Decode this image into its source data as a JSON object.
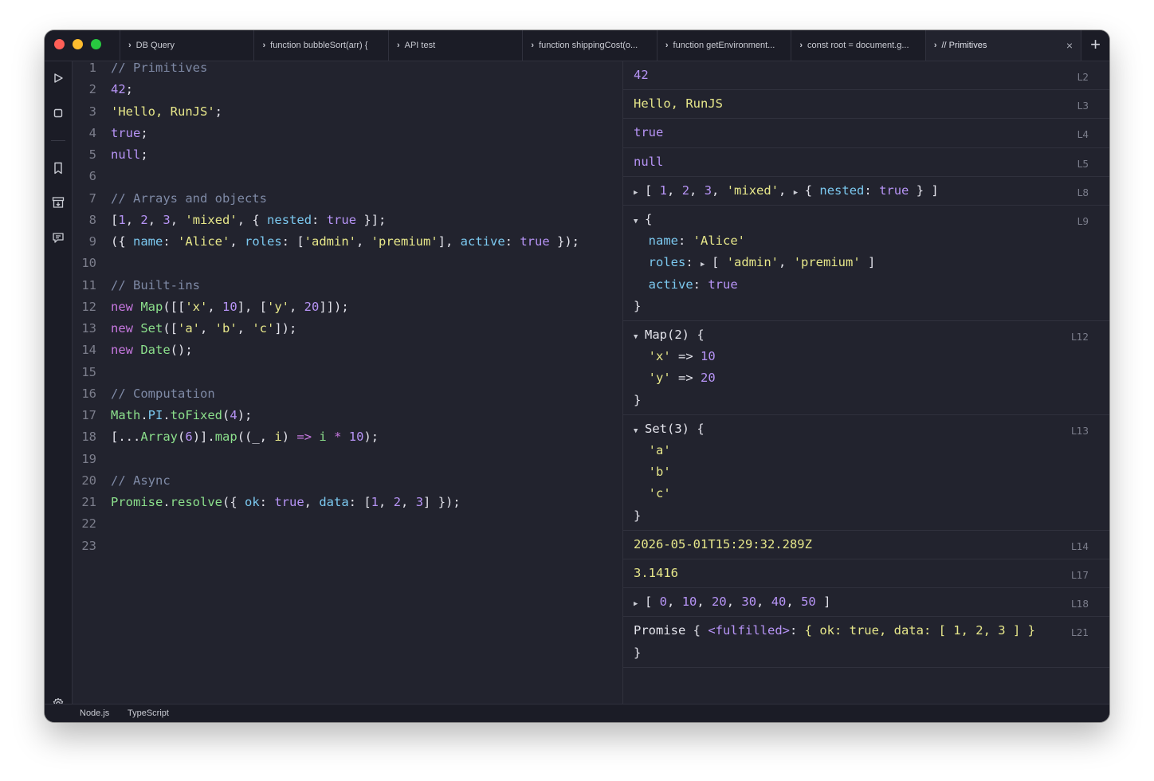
{
  "colors": {
    "window_bg": "#22232e",
    "chrome_bg": "#1b1c26",
    "close_light": "#ff5f57",
    "minimize_light": "#febc2e",
    "zoom_light": "#28c840",
    "comment": "#7f8aa6",
    "number": "#b794f6",
    "string": "#e7e78a",
    "keyword": "#c778e0",
    "class": "#8ce08c",
    "property": "#7cc9f0"
  },
  "tabs": [
    {
      "label": "DB Query"
    },
    {
      "label": "function bubbleSort(arr) {"
    },
    {
      "label": "API test"
    },
    {
      "label": "function shippingCost(o..."
    },
    {
      "label": "function getEnvironment..."
    },
    {
      "label": "const root = document.g..."
    },
    {
      "label": "// Primitives",
      "active": true
    }
  ],
  "tab_close_glyph": "×",
  "new_tab_glyph": "+",
  "sidebar": {
    "icons": [
      "play-icon",
      "stop-icon",
      "bookmark-icon",
      "archive-icon",
      "chat-icon",
      "gear-icon"
    ]
  },
  "editor": {
    "lines": [
      {
        "n": "1",
        "tokens": [
          [
            "c-cmt",
            "// Primitives"
          ]
        ]
      },
      {
        "n": "2",
        "tokens": [
          [
            "c-num",
            "42"
          ],
          [
            "c-punc",
            ";"
          ]
        ]
      },
      {
        "n": "3",
        "tokens": [
          [
            "c-str",
            "'Hello, RunJS'"
          ],
          [
            "c-punc",
            ";"
          ]
        ]
      },
      {
        "n": "4",
        "tokens": [
          [
            "c-bool",
            "true"
          ],
          [
            "c-punc",
            ";"
          ]
        ]
      },
      {
        "n": "5",
        "tokens": [
          [
            "c-bool",
            "null"
          ],
          [
            "c-punc",
            ";"
          ]
        ]
      },
      {
        "n": "6",
        "tokens": []
      },
      {
        "n": "7",
        "tokens": [
          [
            "c-cmt",
            "// Arrays and objects"
          ]
        ]
      },
      {
        "n": "8",
        "tokens": [
          [
            "c-punc",
            "["
          ],
          [
            "c-num",
            "1"
          ],
          [
            "c-punc",
            ", "
          ],
          [
            "c-num",
            "2"
          ],
          [
            "c-punc",
            ", "
          ],
          [
            "c-num",
            "3"
          ],
          [
            "c-punc",
            ", "
          ],
          [
            "c-str",
            "'mixed'"
          ],
          [
            "c-punc",
            ", { "
          ],
          [
            "c-prop",
            "nested"
          ],
          [
            "c-punc",
            ": "
          ],
          [
            "c-bool",
            "true"
          ],
          [
            "c-punc",
            " }];"
          ]
        ]
      },
      {
        "n": "9",
        "tokens": [
          [
            "c-punc",
            "({ "
          ],
          [
            "c-prop",
            "name"
          ],
          [
            "c-punc",
            ": "
          ],
          [
            "c-str",
            "'Alice'"
          ],
          [
            "c-punc",
            ", "
          ],
          [
            "c-prop",
            "roles"
          ],
          [
            "c-punc",
            ": ["
          ],
          [
            "c-str",
            "'admin'"
          ],
          [
            "c-punc",
            ", "
          ],
          [
            "c-str",
            "'premium'"
          ],
          [
            "c-punc",
            "], "
          ],
          [
            "c-prop",
            "active"
          ],
          [
            "c-punc",
            ": "
          ],
          [
            "c-bool",
            "true"
          ],
          [
            "c-punc",
            " });"
          ]
        ]
      },
      {
        "n": "10",
        "tokens": []
      },
      {
        "n": "11",
        "tokens": [
          [
            "c-cmt",
            "// Built-ins"
          ]
        ]
      },
      {
        "n": "12",
        "tokens": [
          [
            "c-kw",
            "new "
          ],
          [
            "c-cls",
            "Map"
          ],
          [
            "c-punc",
            "([["
          ],
          [
            "c-str",
            "'x'"
          ],
          [
            "c-punc",
            ", "
          ],
          [
            "c-num",
            "10"
          ],
          [
            "c-punc",
            "], ["
          ],
          [
            "c-str",
            "'y'"
          ],
          [
            "c-punc",
            ", "
          ],
          [
            "c-num",
            "20"
          ],
          [
            "c-punc",
            "]]);"
          ]
        ]
      },
      {
        "n": "13",
        "tokens": [
          [
            "c-kw",
            "new "
          ],
          [
            "c-cls",
            "Set"
          ],
          [
            "c-punc",
            "(["
          ],
          [
            "c-str",
            "'a'"
          ],
          [
            "c-punc",
            ", "
          ],
          [
            "c-str",
            "'b'"
          ],
          [
            "c-punc",
            ", "
          ],
          [
            "c-str",
            "'c'"
          ],
          [
            "c-punc",
            "]);"
          ]
        ]
      },
      {
        "n": "14",
        "tokens": [
          [
            "c-kw",
            "new "
          ],
          [
            "c-cls",
            "Date"
          ],
          [
            "c-punc",
            "();"
          ]
        ]
      },
      {
        "n": "15",
        "tokens": []
      },
      {
        "n": "16",
        "tokens": [
          [
            "c-cmt",
            "// Computation"
          ]
        ]
      },
      {
        "n": "17",
        "tokens": [
          [
            "c-cls",
            "Math"
          ],
          [
            "c-punc",
            "."
          ],
          [
            "c-prop",
            "PI"
          ],
          [
            "c-punc",
            "."
          ],
          [
            "c-cls",
            "toFixed"
          ],
          [
            "c-punc",
            "("
          ],
          [
            "c-num",
            "4"
          ],
          [
            "c-punc",
            ");"
          ]
        ]
      },
      {
        "n": "18",
        "tokens": [
          [
            "c-punc",
            "[..."
          ],
          [
            "c-cls",
            "Array"
          ],
          [
            "c-punc",
            "("
          ],
          [
            "c-num",
            "6"
          ],
          [
            "c-punc",
            ")]."
          ],
          [
            "c-cls",
            "map"
          ],
          [
            "c-punc",
            "((_, "
          ],
          [
            "c-str",
            "i"
          ],
          [
            "c-punc",
            ") "
          ],
          [
            "c-kw",
            "=>"
          ],
          [
            "c-punc",
            " "
          ],
          [
            "c-cls",
            "i"
          ],
          [
            "c-punc",
            " "
          ],
          [
            "c-kw",
            "*"
          ],
          [
            "c-punc",
            " "
          ],
          [
            "c-num",
            "10"
          ],
          [
            "c-punc",
            ");"
          ]
        ]
      },
      {
        "n": "19",
        "tokens": []
      },
      {
        "n": "20",
        "tokens": [
          [
            "c-cmt",
            "// Async"
          ]
        ]
      },
      {
        "n": "21",
        "tokens": [
          [
            "c-cls",
            "Promise"
          ],
          [
            "c-punc",
            "."
          ],
          [
            "c-cls",
            "resolve"
          ],
          [
            "c-punc",
            "({ "
          ],
          [
            "c-prop",
            "ok"
          ],
          [
            "c-punc",
            ": "
          ],
          [
            "c-bool",
            "true"
          ],
          [
            "c-punc",
            ", "
          ],
          [
            "c-prop",
            "data"
          ],
          [
            "c-punc",
            ": ["
          ],
          [
            "c-num",
            "1"
          ],
          [
            "c-punc",
            ", "
          ],
          [
            "c-num",
            "2"
          ],
          [
            "c-punc",
            ", "
          ],
          [
            "c-num",
            "3"
          ],
          [
            "c-punc",
            "] });"
          ]
        ]
      },
      {
        "n": "22",
        "tokens": []
      },
      {
        "n": "23",
        "tokens": []
      }
    ]
  },
  "output": {
    "rows": [
      {
        "ref": "L2",
        "lines": [
          [
            [
              "o-pur",
              "42"
            ]
          ]
        ]
      },
      {
        "ref": "L3",
        "lines": [
          [
            [
              "o-yel",
              "Hello, RunJS"
            ]
          ]
        ]
      },
      {
        "ref": "L4",
        "lines": [
          [
            [
              "o-pur",
              "true"
            ]
          ]
        ]
      },
      {
        "ref": "L5",
        "lines": [
          [
            [
              "o-pur",
              "null"
            ]
          ]
        ]
      },
      {
        "ref": "L8",
        "lines": [
          [
            [
              "tri",
              "▶"
            ],
            [
              "",
              "[ "
            ],
            [
              "o-pur",
              "1"
            ],
            [
              "",
              ", "
            ],
            [
              "o-pur",
              "2"
            ],
            [
              "",
              ", "
            ],
            [
              "o-pur",
              "3"
            ],
            [
              "",
              ", "
            ],
            [
              "o-str",
              "'mixed'"
            ],
            [
              "",
              ", "
            ],
            [
              "tri",
              "▶"
            ],
            [
              "",
              "{ "
            ],
            [
              "o-prop",
              "nested"
            ],
            [
              "",
              ": "
            ],
            [
              "o-pur",
              "true"
            ],
            [
              "",
              " } ]"
            ]
          ]
        ]
      },
      {
        "ref": "L9",
        "lines": [
          [
            [
              "tri",
              "▼"
            ],
            [
              "",
              "{"
            ]
          ],
          [
            [
              "",
              "  "
            ],
            [
              "o-prop",
              "name"
            ],
            [
              "",
              ": "
            ],
            [
              "o-str",
              "'Alice'"
            ]
          ],
          [
            [
              "",
              "  "
            ],
            [
              "o-prop",
              "roles"
            ],
            [
              "",
              ": "
            ],
            [
              "tri",
              "▶"
            ],
            [
              "",
              "[ "
            ],
            [
              "o-str",
              "'admin'"
            ],
            [
              "",
              ", "
            ],
            [
              "o-str",
              "'premium'"
            ],
            [
              "",
              " ]"
            ]
          ],
          [
            [
              "",
              "  "
            ],
            [
              "o-prop",
              "active"
            ],
            [
              "",
              ": "
            ],
            [
              "o-pur",
              "true"
            ]
          ],
          [
            [
              "",
              "}"
            ]
          ]
        ]
      },
      {
        "ref": "L12",
        "lines": [
          [
            [
              "tri",
              "▼"
            ],
            [
              "",
              "Map(2) {"
            ]
          ],
          [
            [
              "",
              "  "
            ],
            [
              "o-str",
              "'x'"
            ],
            [
              "",
              " => "
            ],
            [
              "o-pur",
              "10"
            ]
          ],
          [
            [
              "",
              "  "
            ],
            [
              "o-str",
              "'y'"
            ],
            [
              "",
              " => "
            ],
            [
              "o-pur",
              "20"
            ]
          ],
          [
            [
              "",
              "}"
            ]
          ]
        ]
      },
      {
        "ref": "L13",
        "lines": [
          [
            [
              "tri",
              "▼"
            ],
            [
              "",
              "Set(3) {"
            ]
          ],
          [
            [
              "",
              "  "
            ],
            [
              "o-str",
              "'a'"
            ]
          ],
          [
            [
              "",
              "  "
            ],
            [
              "o-str",
              "'b'"
            ]
          ],
          [
            [
              "",
              "  "
            ],
            [
              "o-str",
              "'c'"
            ]
          ],
          [
            [
              "",
              "}"
            ]
          ]
        ]
      },
      {
        "ref": "L14",
        "lines": [
          [
            [
              "o-yel",
              "2026-05-01T15:29:32.289Z"
            ]
          ]
        ]
      },
      {
        "ref": "L17",
        "lines": [
          [
            [
              "o-yel",
              "3.1416"
            ]
          ]
        ]
      },
      {
        "ref": "L18",
        "lines": [
          [
            [
              "tri",
              "▶"
            ],
            [
              "",
              "[ "
            ],
            [
              "o-pur",
              "0"
            ],
            [
              "",
              ", "
            ],
            [
              "o-pur",
              "10"
            ],
            [
              "",
              ", "
            ],
            [
              "o-pur",
              "20"
            ],
            [
              "",
              ", "
            ],
            [
              "o-pur",
              "30"
            ],
            [
              "",
              ", "
            ],
            [
              "o-pur",
              "40"
            ],
            [
              "",
              ", "
            ],
            [
              "o-pur",
              "50"
            ],
            [
              "",
              " ]"
            ]
          ]
        ]
      },
      {
        "ref": "L21",
        "lines": [
          [
            [
              "",
              "Promise { "
            ],
            [
              "o-pur",
              "<fulfilled>"
            ],
            [
              "",
              ": "
            ],
            [
              "o-yel",
              "{ ok: true, data: [ 1, 2, 3 ] }"
            ]
          ],
          [
            [
              "",
              "}"
            ]
          ]
        ]
      }
    ]
  },
  "status": {
    "runtime": "Node.js",
    "language": "TypeScript"
  }
}
